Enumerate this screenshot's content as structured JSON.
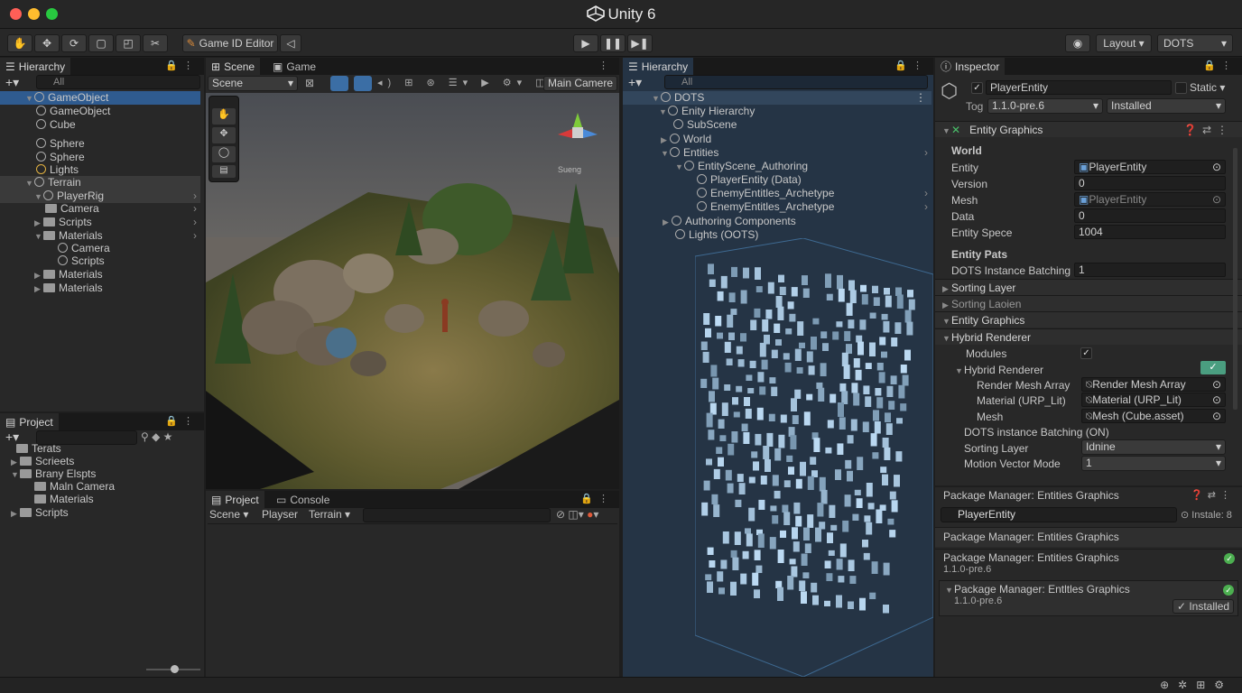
{
  "app": {
    "title": "Unity 6"
  },
  "toolbar": {
    "editor_label": "Game ID Editor",
    "layout": "Layout",
    "layout_mode": "DOTS"
  },
  "hierarchy_left": {
    "tab": "Hierarchy",
    "search_placeholder": "All",
    "items": [
      {
        "label": "GameObject"
      },
      {
        "label": "GameObject"
      },
      {
        "label": "Cube"
      },
      {
        "label": "Sphere"
      },
      {
        "label": "Sphere"
      },
      {
        "label": "Lights"
      },
      {
        "label": "Terrain"
      },
      {
        "label": "PlayerRig"
      },
      {
        "label": "Camera"
      },
      {
        "label": "Scripts"
      },
      {
        "label": "Materials"
      },
      {
        "label": "Camera"
      },
      {
        "label": "Scripts"
      },
      {
        "label": "Materials"
      },
      {
        "label": "Materials"
      }
    ]
  },
  "project_left": {
    "tab": "Project",
    "items": [
      {
        "label": "Terats"
      },
      {
        "label": "Scrieets"
      },
      {
        "label": "Brany Elspts"
      },
      {
        "label": "Maln Camera"
      },
      {
        "label": "Materials"
      },
      {
        "label": "Scripts"
      }
    ]
  },
  "scene": {
    "tab_scene": "Scene",
    "tab_game": "Game",
    "view_dropdown": "Scene",
    "camera_dropdown": "Main Camere",
    "gizmo_label": "Sueng"
  },
  "bottom_center": {
    "tab_project": "Project",
    "tab_console": "Console",
    "filter1": "Scene",
    "filter2": "Playser",
    "filter3": "Terrain"
  },
  "hierarchy_right": {
    "tab": "Hierarchy",
    "search_placeholder": "All",
    "items": [
      {
        "label": "DOTS"
      },
      {
        "label": "Enity Hierarchy"
      },
      {
        "label": "SubScene"
      },
      {
        "label": "World"
      },
      {
        "label": "Entities"
      },
      {
        "label": "EntityScene_Authoring"
      },
      {
        "label": "PlayerEntity (Data)"
      },
      {
        "label": "EnemyEntitles_Archetype"
      },
      {
        "label": "EnemyEntitles_Archetype"
      },
      {
        "label": "Authoring Components"
      },
      {
        "label": "Lights (OOTS)"
      }
    ]
  },
  "inspector": {
    "tab": "Inspector",
    "object_name": "PlayerEntity",
    "static_label": "Static",
    "tag_label": "Tog",
    "tag_value": "1.1.0-pre.6",
    "installed_value": "Installed",
    "component_title": "Entity Graphics",
    "world_header": "World",
    "fields": [
      {
        "label": "Entity",
        "value": "PlayerEntity"
      },
      {
        "label": "Version",
        "value": "0"
      },
      {
        "label": "Mesh",
        "value": "PlayerEntity"
      },
      {
        "label": "Data",
        "value": "0"
      },
      {
        "label": "Entity Spece",
        "value": "1004"
      }
    ],
    "entity_pats_header": "Entity Pats",
    "dots_batching_label": "DOTS Instance Batching (",
    "dots_batching_value": "1",
    "sorting_layer": "Sorting Layer",
    "sorting_lation": "Sorting Laoien",
    "entity_graphics": "Entity Graphics",
    "hybrid_renderer": "Hybrid Renderer",
    "modules_label": "Modules",
    "hybrid_renderer_sub": "Hybrid Renderer",
    "render_mesh_array_label": "Render Mesh Array",
    "render_mesh_array_value": "Render Mesh Array",
    "material_label": "Material (URP_Lit)",
    "material_value": "Material (URP_Lit)",
    "mesh_label": "Mesh",
    "mesh_value": "Mesh (Cube.asset)",
    "dots_batching_on": "DOTS instance Batching (ON)",
    "sorting_layer_label": "Sorting Layer",
    "sorting_layer_value": "Idnine",
    "motion_vector_label": "Motion Vector Mode",
    "motion_vector_value": "1"
  },
  "package_manager": {
    "header": "Package Manager: Entities Graphics",
    "search_value": "PlayerEntity",
    "search_right": "Instale: 8",
    "entries": [
      {
        "title": "Package Manager: Entities Graphics"
      },
      {
        "title": "Package Manager: Entities Graphics",
        "version": "1.1.0-pre.6"
      },
      {
        "title": "Package Manager: Entltles Graphics",
        "version": "1.1.0-pre.6",
        "status": "Installed"
      }
    ]
  },
  "colors": {
    "accent": "#2f5b8f",
    "bg": "#282828",
    "green": "#4caf50"
  }
}
